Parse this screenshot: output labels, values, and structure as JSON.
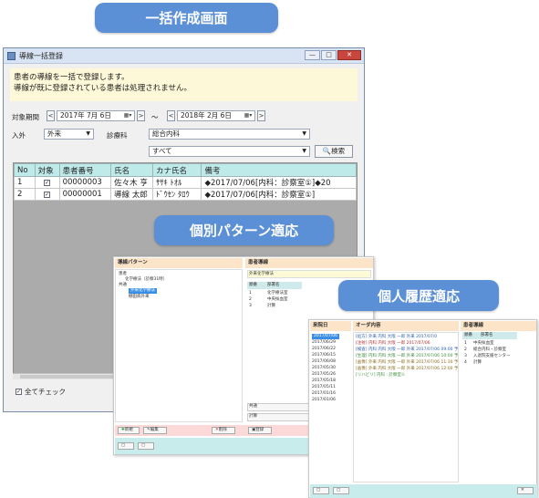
{
  "badges": {
    "bulk": "一括作成画面",
    "pattern": "個別パターン適応",
    "history": "個人履歴適応"
  },
  "window": {
    "title": "導線一括登録",
    "controls": {
      "minimize": "—",
      "maximize": "□",
      "close": "✕"
    },
    "notice": [
      "患者の導線を一括で登録します。",
      "導線が既に登録されている患者は処理されません。"
    ],
    "filters": {
      "period_label": "対象期間",
      "date_from": "2017年 7月 6日",
      "date_to": "2018年 2月 6日",
      "tilde": "〜",
      "inout_label": "入外",
      "inout_value": "外来",
      "dept_label": "診療科",
      "dept_value": "総合内科",
      "second_value": "すべて",
      "search_label": "検索"
    },
    "table": {
      "headers": [
        "No",
        "対象",
        "患者番号",
        "氏名",
        "カナ氏名",
        "備考"
      ],
      "rows": [
        {
          "no": "1",
          "checked": "✓",
          "id": "00000003",
          "name": "佐々木 亨",
          "kana": "ｻｻｷ ﾄｵﾙ",
          "note": "◆2017/07/06[内科：診察室①]◆20"
        },
        {
          "no": "2",
          "checked": "✓",
          "id": "00000001",
          "name": "導線 太郎",
          "kana": "ﾄﾞｳｾﾝ ﾀﾛｳ",
          "note": "◆2017/07/06[内科：診察室①]"
        }
      ]
    },
    "all_check_label": "全てチェック"
  },
  "pattern_window": {
    "left_header": "導線パターン",
    "tree": [
      "患者",
      "化学療法（診察31時）",
      "共通",
      "外来化学療法",
      "棚田病外来"
    ],
    "right_header": "患者導線",
    "pattern_name": "外来化学療法",
    "columns": [
      "順番",
      "部署名"
    ],
    "rows": [
      [
        "1",
        "化学療法室"
      ],
      [
        "2",
        "中央採血室"
      ],
      [
        "3",
        "計算"
      ]
    ],
    "right_bottom": [
      "共通",
      "計算"
    ],
    "buttons": {
      "new": "新規",
      "edit": "編集",
      "delete": "削除",
      "register": "登録"
    }
  },
  "history_window": {
    "visit_header": "来院日",
    "visit_dates": [
      "2017/07/06",
      "2017/06/29",
      "2017/06/22",
      "2017/06/15",
      "2017/06/08",
      "2017/05/30",
      "2017/05/26",
      "2017/05/18",
      "2017/05/11",
      "2017/01/16",
      "2017/01/06"
    ],
    "order_header": "オーダ内容",
    "orders": [
      "[処方] 外来 内科 大阪 一郎 外来 2017/07/0",
      "[注射] 内科 内科 大阪 一郎 2017/07/06",
      "[検査] 内科 内科 大阪 一郎 外来 2017/07/06 09:00 予",
      "[生理] 内科 内科 大阪 一郎 外来 2017/07/06 10:00 予",
      "[画像] 外来 内科 大阪 一郎 外来 2017/07/06 11:30 予",
      "[画像] 外来 内科 大阪 一郎 外来 2017/07/06 12:00 予",
      "[リハビリ] 内科 : 診察室①"
    ],
    "route_header": "患者導線",
    "columns": [
      "順番",
      "部署名"
    ],
    "rows": [
      [
        "1",
        "中央採血室"
      ],
      [
        "2",
        "総合内科・診察室"
      ],
      [
        "3",
        "入退院支援センター"
      ],
      [
        "4",
        "計算"
      ]
    ]
  }
}
